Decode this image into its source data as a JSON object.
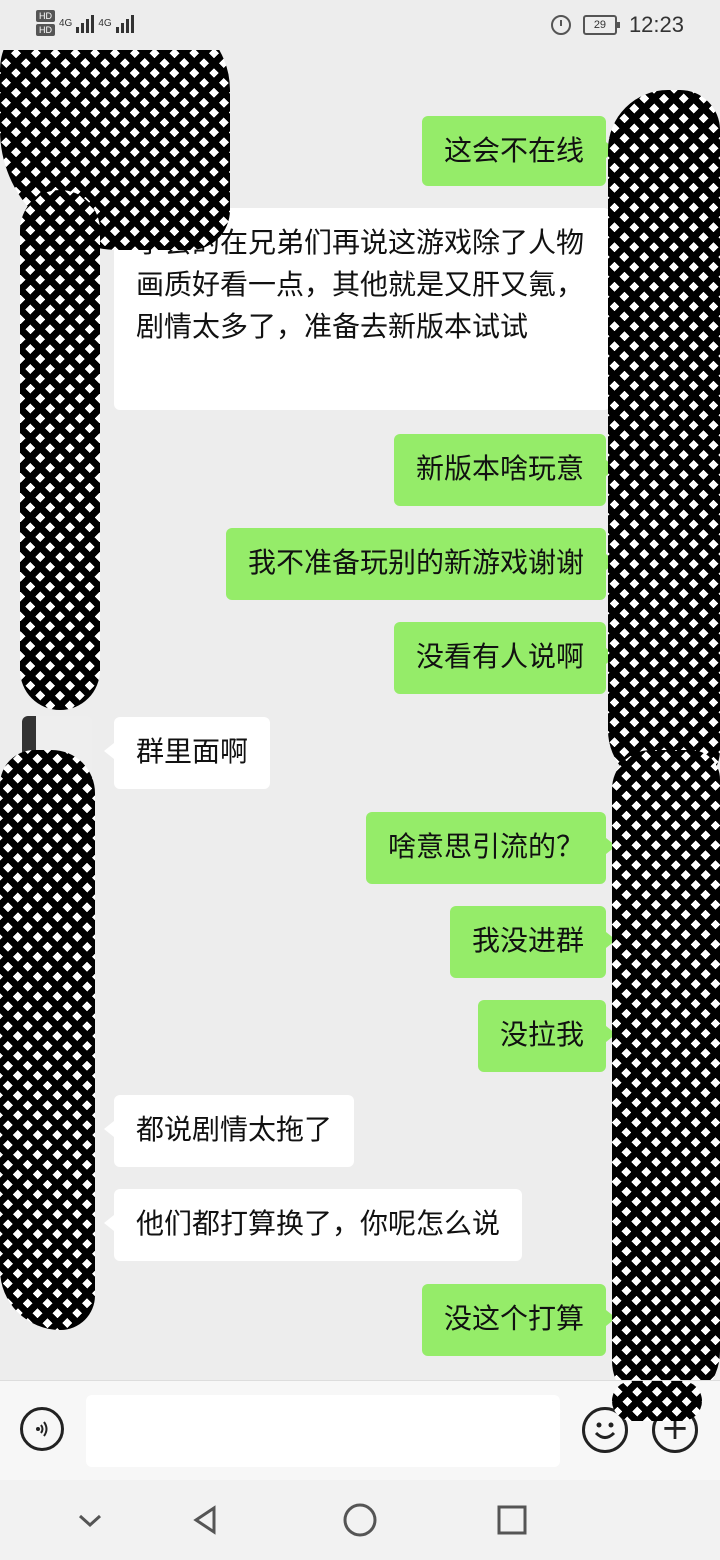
{
  "status_bar": {
    "hd1": "HD",
    "hd2": "HD",
    "net1": "4G",
    "net2": "4G",
    "battery_level": "29",
    "time": "12:23",
    "icons": [
      "alarm-icon",
      "battery-icon",
      "signal-icon"
    ]
  },
  "messages": [
    {
      "side": "out",
      "text": "这会不在线"
    },
    {
      "side": "in",
      "text": "学会的在兄弟们再说这游戏除了人物画质好看一点，其他就是又肝又氪，剧情太多了，准备去新版本试试"
    },
    {
      "side": "out",
      "text": "新版本啥玩意"
    },
    {
      "side": "out",
      "text": "我不准备玩别的新游戏谢谢"
    },
    {
      "side": "out",
      "text": "没看有人说啊"
    },
    {
      "side": "in",
      "text": "群里面啊"
    },
    {
      "side": "out",
      "text": "啥意思引流的？"
    },
    {
      "side": "out",
      "text": "我没进群"
    },
    {
      "side": "out",
      "text": "没拉我"
    },
    {
      "side": "in",
      "text": "都说剧情太拖了"
    },
    {
      "side": "in",
      "text": "他们都打算换了，你呢怎么说"
    },
    {
      "side": "out",
      "text": "没这个打算"
    }
  ],
  "input_bar": {
    "placeholder": "",
    "icons": [
      "voice-icon",
      "emoji-icon",
      "plus-icon"
    ]
  },
  "nav_bar": {
    "icons": [
      "chevron-down-icon",
      "back-triangle-icon",
      "home-circle-icon",
      "recents-square-icon"
    ]
  },
  "colors": {
    "background": "#ededed",
    "outgoing_bubble": "#95ec69",
    "incoming_bubble": "#ffffff"
  }
}
